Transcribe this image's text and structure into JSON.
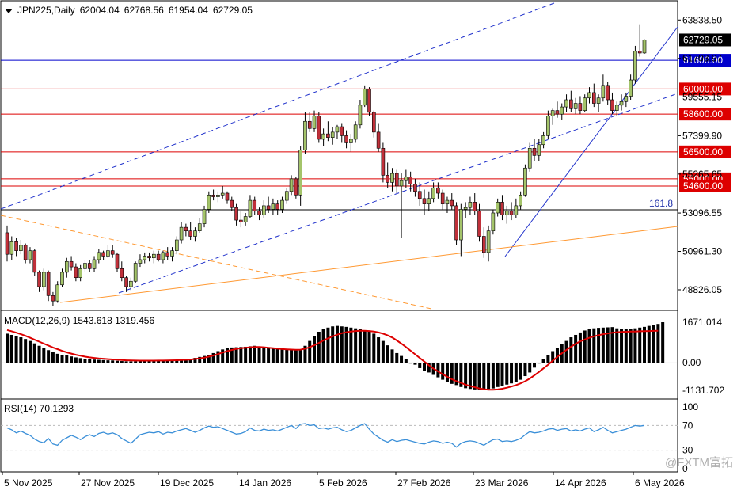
{
  "header": {
    "symbol": "JPN225,Daily",
    "open": "62004.04",
    "high": "62768.56",
    "low": "61954.04",
    "close": "62729.05"
  },
  "price_axis": {
    "ticks": [
      "63838.50",
      "61703.97",
      "59555.15",
      "57399.90",
      "55265.65",
      "53096.55",
      "50961.30",
      "48826.05"
    ],
    "current_price_label": "62729.05",
    "levels": [
      {
        "value": "61600.00",
        "color": "#0000cc"
      },
      {
        "value": "60000.00",
        "color": "#dd0000"
      },
      {
        "value": "58600.00",
        "color": "#dd0000"
      },
      {
        "value": "56500.00",
        "color": "#dd0000"
      },
      {
        "value": "55000.00",
        "color": "#dd0000"
      },
      {
        "value": "54600.00",
        "color": "#dd0000"
      }
    ],
    "fib_label": "161.8"
  },
  "macd": {
    "label": "MACD(12,26,9) 1543.618 1319.456",
    "ticks": [
      "1671.014",
      "0.00",
      "-1131.702"
    ]
  },
  "rsi": {
    "label": "RSI(14) 70.1293",
    "ticks": [
      "100",
      "70",
      "30",
      "0"
    ]
  },
  "time_axis": [
    "5 Nov 2025",
    "27 Nov 2025",
    "19 Dec 2025",
    "14 Jan 2026",
    "5 Feb 2026",
    "27 Feb 2026",
    "23 Mar 2026",
    "14 Apr 2026",
    "6 May 2026"
  ],
  "watermark": "@FXTM富拓",
  "colors": {
    "bull": "#a4c46a",
    "bear": "#c0303a",
    "signal": "#dd0000",
    "rsi": "#3a8fd8",
    "trend": "#2233cc",
    "fib": "#ff9933"
  },
  "chart_data": {
    "type": "candlestick",
    "symbol": "JPN225",
    "timeframe": "Daily",
    "ylim": [
      47900,
      64600
    ],
    "series": [
      {
        "o": 52000,
        "h": 52400,
        "l": 50400,
        "c": 50800
      },
      {
        "o": 50800,
        "h": 51800,
        "l": 50500,
        "c": 51500
      },
      {
        "o": 51500,
        "h": 51700,
        "l": 50700,
        "c": 51000
      },
      {
        "o": 51000,
        "h": 51600,
        "l": 50800,
        "c": 51300
      },
      {
        "o": 51300,
        "h": 51400,
        "l": 50300,
        "c": 50500
      },
      {
        "o": 50500,
        "h": 51200,
        "l": 50300,
        "c": 51000
      },
      {
        "o": 51000,
        "h": 51100,
        "l": 49600,
        "c": 49800
      },
      {
        "o": 49800,
        "h": 49900,
        "l": 48700,
        "c": 49000
      },
      {
        "o": 49000,
        "h": 50000,
        "l": 48800,
        "c": 49800
      },
      {
        "o": 49800,
        "h": 49900,
        "l": 48200,
        "c": 48500
      },
      {
        "o": 48500,
        "h": 48700,
        "l": 47900,
        "c": 48200
      },
      {
        "o": 48200,
        "h": 49300,
        "l": 48100,
        "c": 49100
      },
      {
        "o": 49100,
        "h": 50000,
        "l": 49000,
        "c": 49800
      },
      {
        "o": 49800,
        "h": 50600,
        "l": 49500,
        "c": 50400
      },
      {
        "o": 50400,
        "h": 50700,
        "l": 49900,
        "c": 50100
      },
      {
        "o": 50100,
        "h": 50300,
        "l": 49300,
        "c": 49500
      },
      {
        "o": 49500,
        "h": 50200,
        "l": 49300,
        "c": 50000
      },
      {
        "o": 50000,
        "h": 50500,
        "l": 49800,
        "c": 50300
      },
      {
        "o": 50300,
        "h": 50500,
        "l": 49800,
        "c": 50000
      },
      {
        "o": 50000,
        "h": 50700,
        "l": 49800,
        "c": 50500
      },
      {
        "o": 50500,
        "h": 51100,
        "l": 50300,
        "c": 50900
      },
      {
        "o": 50900,
        "h": 51000,
        "l": 50500,
        "c": 50700
      },
      {
        "o": 50700,
        "h": 51300,
        "l": 50600,
        "c": 51000
      },
      {
        "o": 51000,
        "h": 51300,
        "l": 50600,
        "c": 50800
      },
      {
        "o": 50800,
        "h": 50900,
        "l": 49800,
        "c": 50000
      },
      {
        "o": 50000,
        "h": 50400,
        "l": 49300,
        "c": 49500
      },
      {
        "o": 49500,
        "h": 49600,
        "l": 48700,
        "c": 49000
      },
      {
        "o": 49000,
        "h": 49500,
        "l": 48800,
        "c": 49300
      },
      {
        "o": 49300,
        "h": 50400,
        "l": 49200,
        "c": 50300
      },
      {
        "o": 50300,
        "h": 50800,
        "l": 50100,
        "c": 50500
      },
      {
        "o": 50500,
        "h": 50900,
        "l": 50300,
        "c": 50700
      },
      {
        "o": 50700,
        "h": 50900,
        "l": 50400,
        "c": 50600
      },
      {
        "o": 50600,
        "h": 51000,
        "l": 50300,
        "c": 50800
      },
      {
        "o": 50800,
        "h": 51000,
        "l": 50400,
        "c": 50500
      },
      {
        "o": 50500,
        "h": 51000,
        "l": 50300,
        "c": 50900
      },
      {
        "o": 50900,
        "h": 51200,
        "l": 50500,
        "c": 50700
      },
      {
        "o": 50700,
        "h": 51200,
        "l": 50400,
        "c": 51000
      },
      {
        "o": 51000,
        "h": 51800,
        "l": 50800,
        "c": 51600
      },
      {
        "o": 51600,
        "h": 52600,
        "l": 51400,
        "c": 52300
      },
      {
        "o": 52300,
        "h": 52500,
        "l": 51800,
        "c": 52100
      },
      {
        "o": 52100,
        "h": 52600,
        "l": 51600,
        "c": 51800
      },
      {
        "o": 51800,
        "h": 52300,
        "l": 51500,
        "c": 52100
      },
      {
        "o": 52100,
        "h": 52800,
        "l": 52000,
        "c": 52500
      },
      {
        "o": 52500,
        "h": 53500,
        "l": 52300,
        "c": 53300
      },
      {
        "o": 53300,
        "h": 54300,
        "l": 53100,
        "c": 54100
      },
      {
        "o": 54100,
        "h": 54400,
        "l": 53800,
        "c": 54000
      },
      {
        "o": 54000,
        "h": 54300,
        "l": 53700,
        "c": 54100
      },
      {
        "o": 54100,
        "h": 54600,
        "l": 53900,
        "c": 54200
      },
      {
        "o": 54200,
        "h": 54300,
        "l": 53600,
        "c": 53800
      },
      {
        "o": 53800,
        "h": 54000,
        "l": 53200,
        "c": 53400
      },
      {
        "o": 53400,
        "h": 53600,
        "l": 52400,
        "c": 52700
      },
      {
        "o": 52700,
        "h": 53200,
        "l": 52300,
        "c": 52600
      },
      {
        "o": 52600,
        "h": 53100,
        "l": 52400,
        "c": 52900
      },
      {
        "o": 52900,
        "h": 54100,
        "l": 52800,
        "c": 53800
      },
      {
        "o": 53800,
        "h": 54000,
        "l": 53000,
        "c": 53200
      },
      {
        "o": 53200,
        "h": 53400,
        "l": 52700,
        "c": 53000
      },
      {
        "o": 53000,
        "h": 53800,
        "l": 52800,
        "c": 53500
      },
      {
        "o": 53500,
        "h": 54000,
        "l": 53100,
        "c": 53300
      },
      {
        "o": 53300,
        "h": 53900,
        "l": 53000,
        "c": 53600
      },
      {
        "o": 53600,
        "h": 53800,
        "l": 53000,
        "c": 53300
      },
      {
        "o": 53300,
        "h": 54000,
        "l": 53100,
        "c": 53800
      },
      {
        "o": 53800,
        "h": 54500,
        "l": 53600,
        "c": 54300
      },
      {
        "o": 54300,
        "h": 55200,
        "l": 54100,
        "c": 55000
      },
      {
        "o": 55000,
        "h": 55100,
        "l": 53900,
        "c": 54100
      },
      {
        "o": 54100,
        "h": 56800,
        "l": 53500,
        "c": 56600
      },
      {
        "o": 56600,
        "h": 58700,
        "l": 56400,
        "c": 58200
      },
      {
        "o": 58200,
        "h": 58700,
        "l": 57600,
        "c": 57800
      },
      {
        "o": 57800,
        "h": 58800,
        "l": 57600,
        "c": 58500
      },
      {
        "o": 58500,
        "h": 58700,
        "l": 57000,
        "c": 57200
      },
      {
        "o": 57200,
        "h": 57800,
        "l": 56800,
        "c": 57500
      },
      {
        "o": 57500,
        "h": 58200,
        "l": 57100,
        "c": 57300
      },
      {
        "o": 57300,
        "h": 57900,
        "l": 56900,
        "c": 57600
      },
      {
        "o": 57600,
        "h": 58000,
        "l": 57200,
        "c": 57900
      },
      {
        "o": 57900,
        "h": 58100,
        "l": 57000,
        "c": 57400
      },
      {
        "o": 57400,
        "h": 57700,
        "l": 56700,
        "c": 57000
      },
      {
        "o": 57000,
        "h": 57500,
        "l": 56500,
        "c": 57200
      },
      {
        "o": 57200,
        "h": 58200,
        "l": 57000,
        "c": 58000
      },
      {
        "o": 58000,
        "h": 59400,
        "l": 57800,
        "c": 59100
      },
      {
        "o": 59100,
        "h": 60200,
        "l": 59000,
        "c": 60000
      },
      {
        "o": 60000,
        "h": 60100,
        "l": 58500,
        "c": 58700
      },
      {
        "o": 58700,
        "h": 58800,
        "l": 57300,
        "c": 57600
      },
      {
        "o": 57600,
        "h": 58100,
        "l": 56500,
        "c": 56700
      },
      {
        "o": 56700,
        "h": 57000,
        "l": 54800,
        "c": 55200
      },
      {
        "o": 55200,
        "h": 55900,
        "l": 54500,
        "c": 54800
      },
      {
        "o": 54800,
        "h": 55600,
        "l": 54300,
        "c": 55300
      },
      {
        "o": 55300,
        "h": 55500,
        "l": 54200,
        "c": 54600
      },
      {
        "o": 54600,
        "h": 55300,
        "l": 51700,
        "c": 54900
      },
      {
        "o": 54900,
        "h": 55500,
        "l": 54500,
        "c": 55100
      },
      {
        "o": 55100,
        "h": 55400,
        "l": 54300,
        "c": 54700
      },
      {
        "o": 54700,
        "h": 55000,
        "l": 54000,
        "c": 54300
      },
      {
        "o": 54300,
        "h": 54800,
        "l": 53500,
        "c": 53900
      },
      {
        "o": 53900,
        "h": 54400,
        "l": 53000,
        "c": 53600
      },
      {
        "o": 53600,
        "h": 54300,
        "l": 53200,
        "c": 53900
      },
      {
        "o": 53900,
        "h": 54800,
        "l": 53700,
        "c": 54500
      },
      {
        "o": 54500,
        "h": 54800,
        "l": 53900,
        "c": 54200
      },
      {
        "o": 54200,
        "h": 54400,
        "l": 53300,
        "c": 53600
      },
      {
        "o": 53600,
        "h": 54000,
        "l": 53100,
        "c": 53800
      },
      {
        "o": 53800,
        "h": 54200,
        "l": 53300,
        "c": 53500
      },
      {
        "o": 53500,
        "h": 53700,
        "l": 51300,
        "c": 51600
      },
      {
        "o": 51600,
        "h": 53600,
        "l": 50700,
        "c": 53300
      },
      {
        "o": 53300,
        "h": 53700,
        "l": 52800,
        "c": 53400
      },
      {
        "o": 53400,
        "h": 54000,
        "l": 53000,
        "c": 53700
      },
      {
        "o": 53700,
        "h": 54200,
        "l": 53000,
        "c": 53200
      },
      {
        "o": 53200,
        "h": 53600,
        "l": 51500,
        "c": 51800
      },
      {
        "o": 51800,
        "h": 52300,
        "l": 50600,
        "c": 50900
      },
      {
        "o": 50900,
        "h": 52400,
        "l": 50400,
        "c": 52100
      },
      {
        "o": 52100,
        "h": 53300,
        "l": 51900,
        "c": 53100
      },
      {
        "o": 53100,
        "h": 53900,
        "l": 52900,
        "c": 53700
      },
      {
        "o": 53700,
        "h": 54100,
        "l": 52700,
        "c": 53000
      },
      {
        "o": 53000,
        "h": 53500,
        "l": 52500,
        "c": 53200
      },
      {
        "o": 53200,
        "h": 53700,
        "l": 52700,
        "c": 53000
      },
      {
        "o": 53000,
        "h": 53900,
        "l": 52800,
        "c": 53500
      },
      {
        "o": 53500,
        "h": 54300,
        "l": 53300,
        "c": 54100
      },
      {
        "o": 54100,
        "h": 55800,
        "l": 54000,
        "c": 55600
      },
      {
        "o": 55600,
        "h": 57000,
        "l": 55400,
        "c": 56700
      },
      {
        "o": 56700,
        "h": 57200,
        "l": 56000,
        "c": 56300
      },
      {
        "o": 56300,
        "h": 57200,
        "l": 56000,
        "c": 56900
      },
      {
        "o": 56900,
        "h": 57600,
        "l": 56700,
        "c": 57400
      },
      {
        "o": 57400,
        "h": 58800,
        "l": 57200,
        "c": 58500
      },
      {
        "o": 58500,
        "h": 58900,
        "l": 58000,
        "c": 58800
      },
      {
        "o": 58800,
        "h": 59300,
        "l": 58400,
        "c": 58600
      },
      {
        "o": 58600,
        "h": 59200,
        "l": 58300,
        "c": 59000
      },
      {
        "o": 59000,
        "h": 59700,
        "l": 58700,
        "c": 59400
      },
      {
        "o": 59400,
        "h": 59900,
        "l": 58700,
        "c": 58900
      },
      {
        "o": 58900,
        "h": 59500,
        "l": 58600,
        "c": 59200
      },
      {
        "o": 59200,
        "h": 59600,
        "l": 58600,
        "c": 58800
      },
      {
        "o": 58800,
        "h": 59700,
        "l": 58700,
        "c": 59500
      },
      {
        "o": 59500,
        "h": 60100,
        "l": 59200,
        "c": 59800
      },
      {
        "o": 59800,
        "h": 60300,
        "l": 59000,
        "c": 59200
      },
      {
        "o": 59200,
        "h": 59700,
        "l": 58700,
        "c": 59500
      },
      {
        "o": 59500,
        "h": 60800,
        "l": 59300,
        "c": 60200
      },
      {
        "o": 60200,
        "h": 60400,
        "l": 59100,
        "c": 59400
      },
      {
        "o": 59400,
        "h": 59800,
        "l": 58600,
        "c": 58800
      },
      {
        "o": 58800,
        "h": 59300,
        "l": 58500,
        "c": 59100
      },
      {
        "o": 59100,
        "h": 59700,
        "l": 58800,
        "c": 59300
      },
      {
        "o": 59300,
        "h": 59800,
        "l": 59000,
        "c": 59600
      },
      {
        "o": 59600,
        "h": 60800,
        "l": 59400,
        "c": 60500
      },
      {
        "o": 60500,
        "h": 62400,
        "l": 60300,
        "c": 62100
      },
      {
        "o": 62100,
        "h": 63600,
        "l": 61800,
        "c": 62000
      },
      {
        "o": 62004.04,
        "h": 62768.56,
        "l": 61954.04,
        "c": 62729.05
      }
    ],
    "macd_values": [
      1200,
      1150,
      1100,
      1050,
      980,
      900,
      800,
      700,
      620,
      520,
      430,
      370,
      330,
      300,
      260,
      220,
      190,
      160,
      140,
      130,
      120,
      110,
      100,
      95,
      80,
      70,
      60,
      55,
      60,
      65,
      70,
      72,
      75,
      78,
      80,
      85,
      90,
      95,
      105,
      130,
      160,
      200,
      240,
      280,
      330,
      400,
      480,
      550,
      600,
      630,
      640,
      650,
      660,
      680,
      700,
      650,
      620,
      600,
      580,
      560,
      560,
      550,
      540,
      540,
      560,
      700,
      900,
      1100,
      1280,
      1380,
      1450,
      1500,
      1520,
      1500,
      1480,
      1450,
      1420,
      1380,
      1330,
      1280,
      1200,
      1050,
      900,
      720,
      550,
      400,
      280,
      150,
      0,
      -80,
      -220,
      -320,
      -400,
      -500,
      -600,
      -700,
      -800,
      -870,
      -920,
      -1000,
      -1050,
      -1080,
      -1100,
      -1131,
      -1100,
      -1080,
      -1060,
      -1000,
      -950,
      -900,
      -850,
      -780,
      -700,
      -550,
      -400,
      -200,
      0,
      150,
      320,
      480,
      620,
      760,
      900,
      1050,
      1150,
      1250,
      1330,
      1380,
      1420,
      1440,
      1450,
      1460,
      1470,
      1420,
      1400,
      1380,
      1390,
      1420,
      1450,
      1480,
      1520,
      1560,
      1600,
      1671
    ],
    "macd_signal": [
      1350,
      1300,
      1240,
      1180,
      1110,
      1030,
      950,
      870,
      790,
      710,
      630,
      560,
      490,
      430,
      380,
      330,
      290,
      250,
      220,
      200,
      180,
      165,
      150,
      138,
      125,
      112,
      102,
      95,
      90,
      88,
      87,
      87,
      88,
      90,
      92,
      95,
      100,
      105,
      112,
      120,
      135,
      155,
      180,
      210,
      250,
      300,
      360,
      420,
      480,
      530,
      570,
      600,
      620,
      640,
      650,
      650,
      640,
      620,
      600,
      580,
      565,
      555,
      545,
      535,
      540,
      580,
      640,
      720,
      820,
      920,
      1010,
      1090,
      1160,
      1220,
      1260,
      1290,
      1310,
      1320,
      1320,
      1310,
      1290,
      1250,
      1200,
      1130,
      1040,
      920,
      790,
      650,
      500,
      350,
      200,
      50,
      -100,
      -240,
      -360,
      -470,
      -580,
      -680,
      -760,
      -830,
      -900,
      -960,
      -1010,
      -1060,
      -1090,
      -1110,
      -1115,
      -1100,
      -1070,
      -1030,
      -980,
      -920,
      -850,
      -760,
      -650,
      -520,
      -380,
      -230,
      -80,
      80,
      240,
      390,
      530,
      660,
      780,
      880,
      960,
      1030,
      1090,
      1140,
      1180,
      1210,
      1240,
      1260,
      1270,
      1280,
      1285,
      1290,
      1300,
      1305,
      1310,
      1315,
      1319.456
    ],
    "rsi_values": [
      66,
      63,
      58,
      61,
      57,
      54,
      48,
      44,
      42,
      49,
      40,
      38,
      46,
      50,
      54,
      51,
      47,
      52,
      55,
      52,
      57,
      59,
      56,
      58,
      55,
      49,
      45,
      41,
      48,
      55,
      57,
      59,
      58,
      60,
      56,
      59,
      58,
      61,
      63,
      65,
      62,
      59,
      62,
      66,
      69,
      67,
      68,
      65,
      62,
      59,
      56,
      57,
      60,
      66,
      62,
      61,
      64,
      62,
      63,
      61,
      64,
      67,
      70,
      65,
      72,
      73,
      70,
      71,
      65,
      66,
      64,
      66,
      67,
      63,
      60,
      62,
      66,
      70,
      73,
      64,
      56,
      51,
      46,
      43,
      47,
      44,
      46,
      47,
      45,
      43,
      41,
      40,
      43,
      45,
      44,
      41,
      43,
      41,
      35,
      41,
      44,
      45,
      44,
      41,
      38,
      43,
      47,
      48,
      44,
      45,
      44,
      46,
      49,
      55,
      60,
      58,
      59,
      61,
      64,
      65,
      62,
      64,
      65,
      61,
      63,
      61,
      64,
      66,
      60,
      63,
      67,
      62,
      58,
      60,
      62,
      64,
      67,
      70,
      69,
      70.1293
    ]
  }
}
